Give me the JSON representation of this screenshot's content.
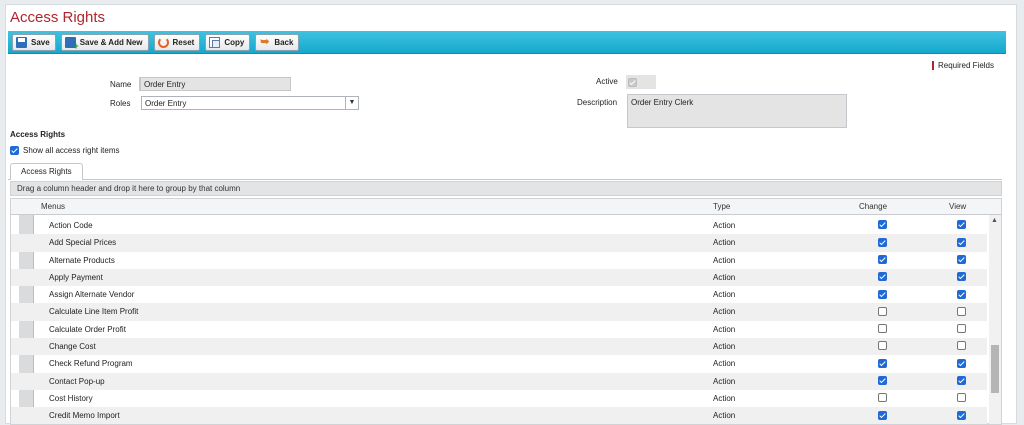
{
  "page_title": "Access Rights",
  "toolbar": {
    "save": "Save",
    "save_add_new": "Save & Add New",
    "reset": "Reset",
    "copy": "Copy",
    "back": "Back"
  },
  "required_fields": "Required Fields",
  "form": {
    "name_label": "Name",
    "name_value": "Order Entry",
    "roles_label": "Roles",
    "roles_value": "Order Entry",
    "active_label": "Active",
    "active_checked": true,
    "description_label": "Description",
    "description_value": "Order Entry Clerk"
  },
  "section_title": "Access Rights",
  "show_all_label": "Show all access right items",
  "show_all_checked": true,
  "tab_label": "Access Rights",
  "group_hint": "Drag a column header and drop it here to group by that column",
  "columns": {
    "menus": "Menus",
    "type": "Type",
    "change": "Change",
    "view": "View"
  },
  "rows": [
    {
      "name": "Action Code",
      "type": "Action",
      "change": true,
      "view": true
    },
    {
      "name": "Add Special Prices",
      "type": "Action",
      "change": true,
      "view": true
    },
    {
      "name": "Alternate Products",
      "type": "Action",
      "change": true,
      "view": true
    },
    {
      "name": "Apply Payment",
      "type": "Action",
      "change": true,
      "view": true
    },
    {
      "name": "Assign Alternate Vendor",
      "type": "Action",
      "change": true,
      "view": true
    },
    {
      "name": "Calculate Line Item Profit",
      "type": "Action",
      "change": false,
      "view": false
    },
    {
      "name": "Calculate Order Profit",
      "type": "Action",
      "change": false,
      "view": false
    },
    {
      "name": "Change Cost",
      "type": "Action",
      "change": false,
      "view": false
    },
    {
      "name": "Check Refund Program",
      "type": "Action",
      "change": true,
      "view": true
    },
    {
      "name": "Contact Pop-up",
      "type": "Action",
      "change": true,
      "view": true
    },
    {
      "name": "Cost History",
      "type": "Action",
      "change": false,
      "view": false
    },
    {
      "name": "Credit Memo Import",
      "type": "Action",
      "change": true,
      "view": true
    }
  ]
}
